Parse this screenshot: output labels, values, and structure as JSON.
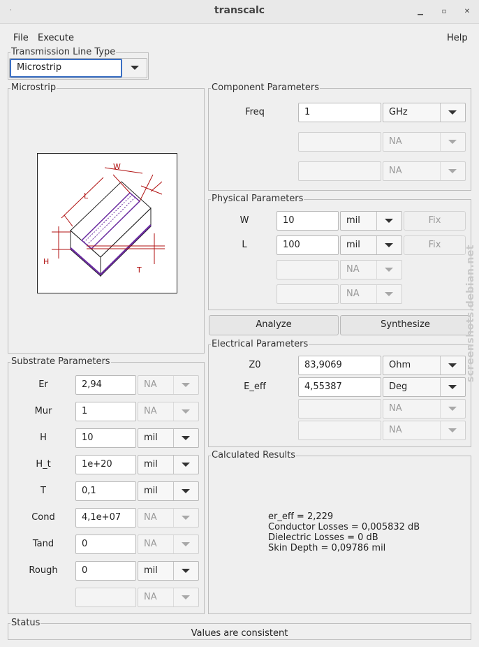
{
  "window": {
    "title": "transcalc",
    "menu_icon": "window-menu-icon",
    "minimize": "minimize-icon",
    "maximize": "maximize-icon",
    "close": "close-icon"
  },
  "menu": {
    "file": "File",
    "execute": "Execute",
    "help": "Help"
  },
  "line_type": {
    "group_title": "Transmission Line Type",
    "value": "Microstrip"
  },
  "diagram": {
    "group_title": "Microstrip",
    "labels": {
      "w": "W",
      "l": "L",
      "h": "H",
      "t": "T"
    }
  },
  "substrate": {
    "group_title": "Substrate Parameters",
    "rows": [
      {
        "label": "Er",
        "value": "2,94",
        "unit": "NA",
        "unit_enabled": false
      },
      {
        "label": "Mur",
        "value": "1",
        "unit": "NA",
        "unit_enabled": false
      },
      {
        "label": "H",
        "value": "10",
        "unit": "mil",
        "unit_enabled": true
      },
      {
        "label": "H_t",
        "value": "1e+20",
        "unit": "mil",
        "unit_enabled": true
      },
      {
        "label": "T",
        "value": "0,1",
        "unit": "mil",
        "unit_enabled": true
      },
      {
        "label": "Cond",
        "value": "4,1e+07",
        "unit": "NA",
        "unit_enabled": false
      },
      {
        "label": "Tand",
        "value": "0",
        "unit": "NA",
        "unit_enabled": false
      },
      {
        "label": "Rough",
        "value": "0",
        "unit": "mil",
        "unit_enabled": true
      },
      {
        "label": "",
        "value": "",
        "unit": "NA",
        "unit_enabled": false
      }
    ]
  },
  "component": {
    "group_title": "Component Parameters",
    "rows": [
      {
        "label": "Freq",
        "value": "1",
        "unit": "GHz",
        "unit_enabled": true
      },
      {
        "label": "",
        "value": "",
        "unit": "NA",
        "unit_enabled": false
      },
      {
        "label": "",
        "value": "",
        "unit": "NA",
        "unit_enabled": false
      }
    ]
  },
  "physical": {
    "group_title": "Physical Parameters",
    "fix_label": "Fix",
    "rows": [
      {
        "label": "W",
        "value": "10",
        "unit": "mil",
        "unit_enabled": true
      },
      {
        "label": "L",
        "value": "100",
        "unit": "mil",
        "unit_enabled": true
      },
      {
        "label": "",
        "value": "",
        "unit": "NA",
        "unit_enabled": false
      },
      {
        "label": "",
        "value": "",
        "unit": "NA",
        "unit_enabled": false
      }
    ]
  },
  "actions": {
    "analyze": "Analyze",
    "synthesize": "Synthesize"
  },
  "electrical": {
    "group_title": "Electrical Parameters",
    "rows": [
      {
        "label": "Z0",
        "value": "83,9069",
        "unit": "Ohm",
        "unit_enabled": true
      },
      {
        "label": "E_eff",
        "value": "4,55387",
        "unit": "Deg",
        "unit_enabled": true
      },
      {
        "label": "",
        "value": "",
        "unit": "NA",
        "unit_enabled": false
      },
      {
        "label": "",
        "value": "",
        "unit": "NA",
        "unit_enabled": false
      }
    ]
  },
  "results": {
    "group_title": "Calculated Results",
    "lines": [
      "er_eff = 2,229",
      "Conductor Losses = 0,005832 dB",
      "Dielectric Losses = 0 dB",
      "Skin Depth = 0,09786 mil"
    ]
  },
  "status": {
    "group_title": "Status",
    "text": "Values are consistent"
  },
  "watermark": "screenshots.debian.net",
  "colors": {
    "diagram_accent": "#b01010",
    "diagram_hatch": "#6a2ba0"
  }
}
